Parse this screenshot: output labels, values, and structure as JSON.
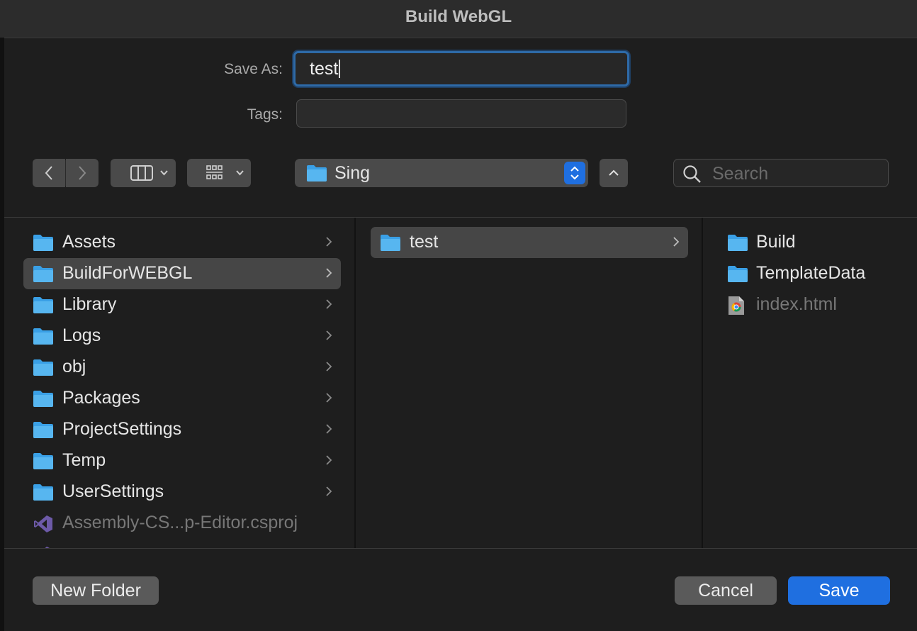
{
  "window": {
    "title": "Build WebGL"
  },
  "form": {
    "save_as_label": "Save As:",
    "save_as_value": "test",
    "tags_label": "Tags:",
    "tags_value": ""
  },
  "toolbar": {
    "back_icon": "chevron-left-icon",
    "forward_icon": "chevron-right-icon",
    "view_mode_icon": "column-view-icon",
    "group_icon": "grid-group-icon",
    "location": "Sing",
    "up_icon": "chevron-up-icon",
    "search_placeholder": "Search"
  },
  "columns": [
    {
      "items": [
        {
          "name": "Assets",
          "type": "folder",
          "has_children": true,
          "selected": false
        },
        {
          "name": "BuildForWEBGL",
          "type": "folder",
          "has_children": true,
          "selected": true
        },
        {
          "name": "Library",
          "type": "folder",
          "has_children": true,
          "selected": false
        },
        {
          "name": "Logs",
          "type": "folder",
          "has_children": true,
          "selected": false
        },
        {
          "name": "obj",
          "type": "folder",
          "has_children": true,
          "selected": false
        },
        {
          "name": "Packages",
          "type": "folder",
          "has_children": true,
          "selected": false
        },
        {
          "name": "ProjectSettings",
          "type": "folder",
          "has_children": true,
          "selected": false
        },
        {
          "name": "Temp",
          "type": "folder",
          "has_children": true,
          "selected": false
        },
        {
          "name": "UserSettings",
          "type": "folder",
          "has_children": true,
          "selected": false
        },
        {
          "name": "Assembly-CS...p-Editor.csproj",
          "type": "csproj",
          "has_children": false,
          "selected": false,
          "dimmed": true
        }
      ]
    },
    {
      "items": [
        {
          "name": "test",
          "type": "folder",
          "has_children": true,
          "selected": true
        }
      ]
    },
    {
      "items": [
        {
          "name": "Build",
          "type": "folder",
          "has_children": false,
          "selected": false
        },
        {
          "name": "TemplateData",
          "type": "folder",
          "has_children": false,
          "selected": false
        },
        {
          "name": "index.html",
          "type": "html",
          "has_children": false,
          "selected": false,
          "dimmed": true
        }
      ]
    }
  ],
  "buttons": {
    "new_folder": "New Folder",
    "cancel": "Cancel",
    "save": "Save"
  },
  "colors": {
    "accent": "#1f6fe0",
    "folder": "#3aa0e6",
    "background": "#1e1e1e"
  }
}
